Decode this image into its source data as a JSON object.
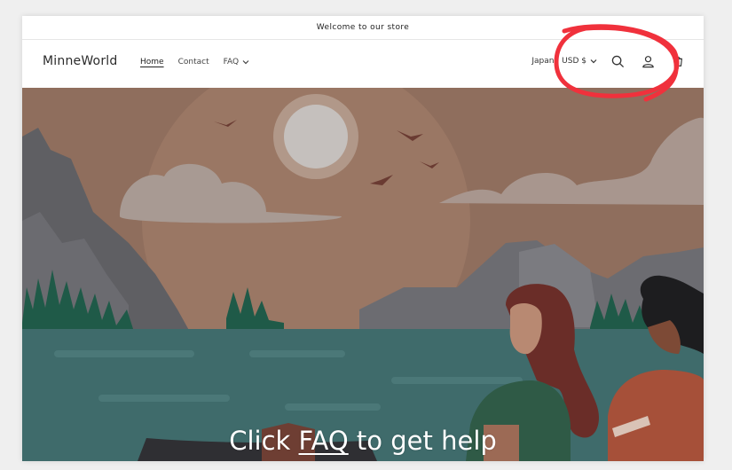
{
  "announcement": {
    "text": "Welcome to our store"
  },
  "header": {
    "logo": "MinneWorld",
    "nav": [
      {
        "label": "Home",
        "active": true
      },
      {
        "label": "Contact",
        "active": false
      },
      {
        "label": "FAQ",
        "active": false,
        "has_dropdown": true
      }
    ],
    "country_selector": "Japan | USD $",
    "icons": [
      "chevron-down-icon",
      "search-icon",
      "account-icon",
      "cart-icon"
    ]
  },
  "hero": {
    "caption_prefix": "Click ",
    "caption_link": "FAQ",
    "caption_suffix": " to get help"
  },
  "colors": {
    "annotation_red": "#f0313c",
    "sky": "#8f6e5d",
    "water": "#3f6b6b",
    "mountain": "#5f5f63",
    "trees": "#1f5a48"
  }
}
